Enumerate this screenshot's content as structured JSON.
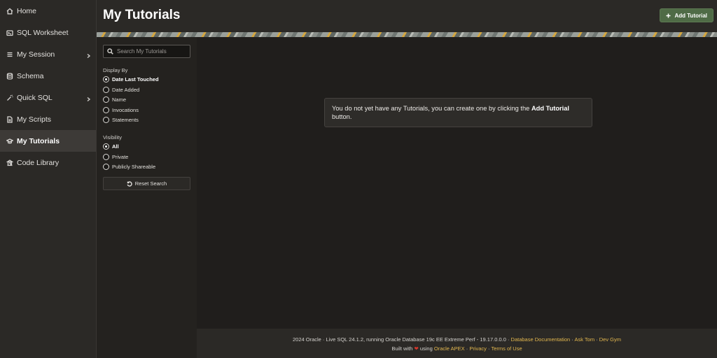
{
  "sidebar": {
    "items": [
      {
        "label": "Home",
        "icon": "home-icon"
      },
      {
        "label": "SQL Worksheet",
        "icon": "worksheet-icon"
      },
      {
        "label": "My Session",
        "icon": "menu-lines-icon",
        "has_children": true
      },
      {
        "label": "Schema",
        "icon": "database-icon"
      },
      {
        "label": "Quick SQL",
        "icon": "magic-wand-icon",
        "has_children": true
      },
      {
        "label": "My Scripts",
        "icon": "file-icon"
      },
      {
        "label": "My Tutorials",
        "icon": "graduation-cap-icon",
        "active": true
      },
      {
        "label": "Code Library",
        "icon": "library-icon"
      }
    ]
  },
  "header": {
    "title": "My Tutorials",
    "add_button_label": "Add Tutorial"
  },
  "filters": {
    "search_placeholder": "Search My Tutorials",
    "display_by_label": "Display By",
    "display_by_options": [
      "Date Last Touched",
      "Date Added",
      "Name",
      "Invocations",
      "Statements"
    ],
    "display_by_selected": "Date Last Touched",
    "visibility_label": "Visibility",
    "visibility_options": [
      "All",
      "Private",
      "Publicly Shareable"
    ],
    "visibility_selected": "All",
    "reset_label": "Reset Search"
  },
  "main": {
    "empty_text_before": "You do not yet have any Tutorials, you can create one by clicking the ",
    "empty_text_bold": "Add Tutorial",
    "empty_text_after": "button."
  },
  "footer": {
    "line1_text": "2024 Oracle · Live SQL 24.1.2, running Oracle Database 19c EE Extreme Perf - 19.17.0.0.0 · ",
    "link_docs": "Database Documentation",
    "sep": " · ",
    "link_asktom": "Ask Tom",
    "link_devgym": "Dev Gym",
    "built_with": "Built with",
    "using": "using",
    "link_apex": "Oracle APEX",
    "link_privacy": "Privacy",
    "link_terms": "Terms of Use"
  },
  "colors": {
    "accent_button": "#4f6b46",
    "link": "#e2b74f",
    "heart": "#d9362b"
  }
}
